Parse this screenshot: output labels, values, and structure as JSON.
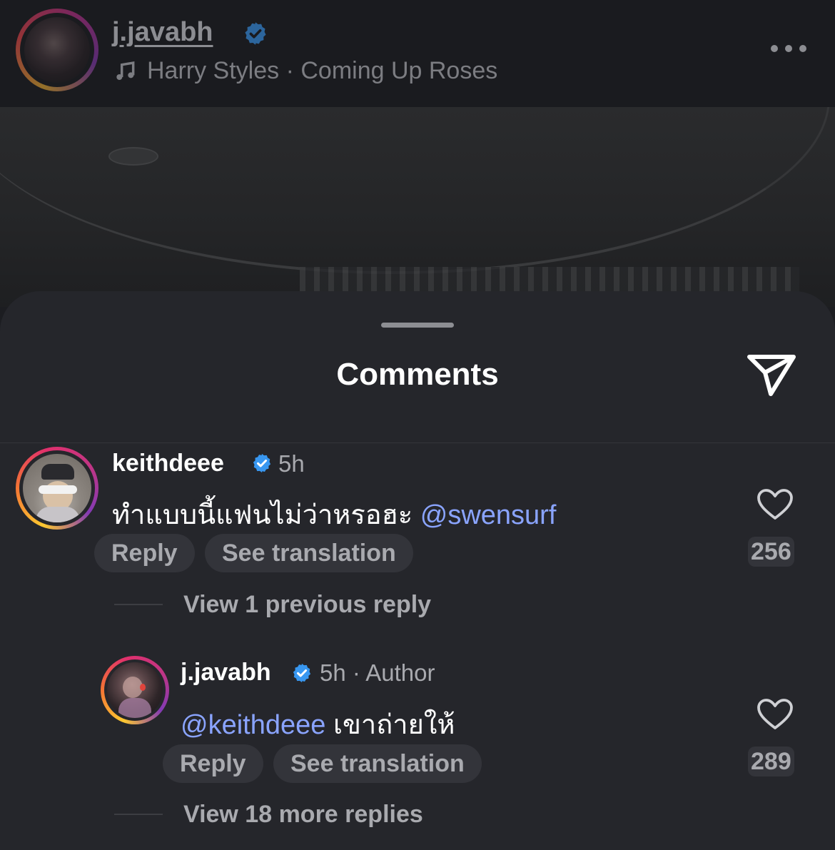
{
  "post": {
    "username": "j.javabh",
    "verified": true,
    "music_icon": "music-note-icon",
    "music_text": "Harry Styles · Coming Up Roses",
    "more_icon": "more-horizontal-icon"
  },
  "sheet": {
    "title": "Comments",
    "share_icon": "paper-plane-icon"
  },
  "comments": [
    {
      "username": "keithdeee",
      "verified": true,
      "time": "5h",
      "text": "ทำแบบนี้แฟนไม่ว่าหรอฮะ",
      "mention": "@swensurf",
      "reply_label": "Reply",
      "translate_label": "See translation",
      "likes": "256",
      "view_replies": "View 1 previous reply"
    },
    {
      "username": "j.javabh",
      "verified": true,
      "time_author": "5h · Author",
      "mention": "@keithdeee",
      "text": "เขาถ่ายให้",
      "reply_label": "Reply",
      "translate_label": "See translation",
      "likes": "289",
      "view_replies": "View 18 more replies"
    }
  ],
  "colors": {
    "background": "#25262b",
    "mention": "#8aa4ff",
    "verified": "#3897f0",
    "muted_text": "#a9aaaf"
  }
}
